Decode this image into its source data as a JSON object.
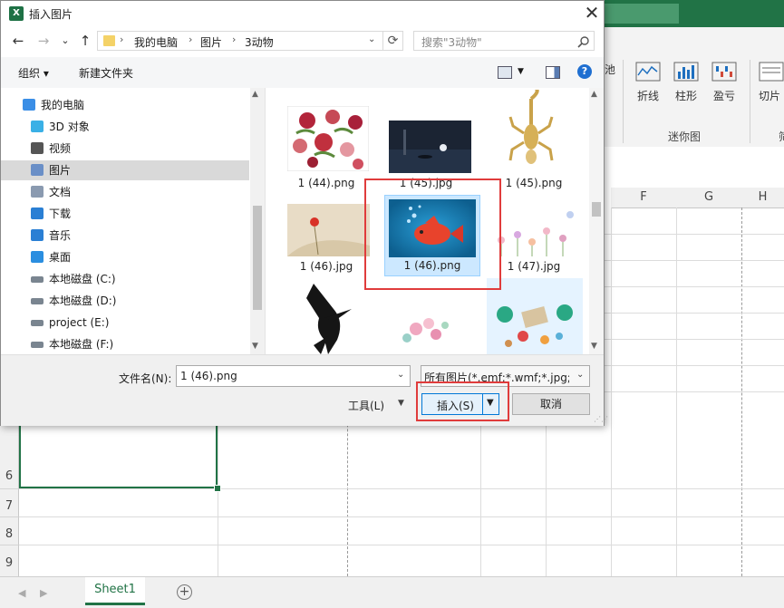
{
  "dialog": {
    "title": "插入图片",
    "close_glyph": "✕",
    "app_icon_letter": "X"
  },
  "nav": {
    "back": "←",
    "forward": "→",
    "recent": "⌄",
    "up": "↑",
    "breadcrumb": [
      "我的电脑",
      "图片",
      "3动物"
    ],
    "refresh": "⟳",
    "search_placeholder": "搜索\"3动物\""
  },
  "toolbar": {
    "organize": "组织 ▾",
    "new_folder": "新建文件夹",
    "help": "?"
  },
  "tree": [
    {
      "label": "我的电脑",
      "icon": "computer-icon",
      "color": "#3a8ee6"
    },
    {
      "label": "3D 对象",
      "icon": "3d-objects-icon",
      "color": "#3ab0e6"
    },
    {
      "label": "视频",
      "icon": "video-icon",
      "color": "#555"
    },
    {
      "label": "图片",
      "icon": "pictures-icon",
      "color": "#6a8fc7"
    },
    {
      "label": "文档",
      "icon": "documents-icon",
      "color": "#8a9ab0"
    },
    {
      "label": "下载",
      "icon": "download-icon",
      "color": "#2a7fd4"
    },
    {
      "label": "音乐",
      "icon": "music-icon",
      "color": "#2a7fd4"
    },
    {
      "label": "桌面",
      "icon": "desktop-icon",
      "color": "#2a8ee0"
    },
    {
      "label": "本地磁盘 (C:)",
      "icon": "drive-icon",
      "color": "#7a8590"
    },
    {
      "label": "本地磁盘 (D:)",
      "icon": "drive-icon",
      "color": "#7a8590"
    },
    {
      "label": "project (E:)",
      "icon": "drive-icon",
      "color": "#7a8590"
    },
    {
      "label": "本地磁盘 (F:)",
      "icon": "drive-icon",
      "color": "#7a8590"
    }
  ],
  "files": [
    {
      "name": "1 (44).png"
    },
    {
      "name": "1 (45).jpg"
    },
    {
      "name": "1 (45).png"
    },
    {
      "name": "1 (46).jpg"
    },
    {
      "name": "1 (46).png"
    },
    {
      "name": "1 (47).jpg"
    },
    {
      "name": ""
    },
    {
      "name": ""
    },
    {
      "name": ""
    }
  ],
  "bottom": {
    "filename_label": "文件名(N):",
    "filename_value": "1 (46).png",
    "filetype": "所有图片(*.emf;*.wmf;*.jpg;*.jp",
    "tools": "工具(L)",
    "insert": "插入(S)",
    "cancel": "取消"
  },
  "excel": {
    "ribbon": [
      "折线",
      "柱形",
      "盈亏",
      "切片"
    ],
    "ribbon_group": "迷你图",
    "ribbon_group_right": "筛",
    "ribbon_left_clip": "池",
    "columns": [
      "F",
      "G",
      "H"
    ],
    "rows": [
      "6",
      "7",
      "8",
      "9"
    ],
    "sheet_tab": "Sheet1",
    "add_sheet": "+"
  },
  "colors": {
    "excel_green": "#217346",
    "highlight_red": "#e03c3c",
    "selection_blue": "#cce8ff"
  }
}
